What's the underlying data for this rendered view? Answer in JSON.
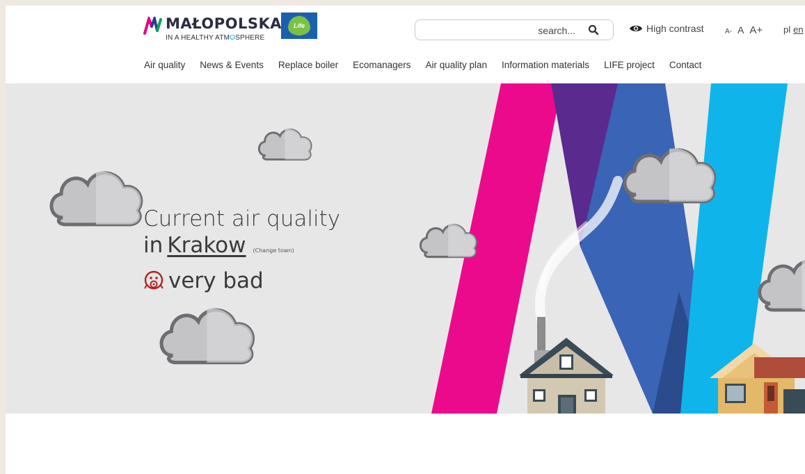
{
  "header": {
    "logo_title": "MAŁOPOLSKA",
    "logo_sub_1": "IN A HEALTHY ATM",
    "logo_sub_accent": "O",
    "logo_sub_2": "SPHERE",
    "life_label": "Life",
    "search": {
      "placeholder": "search..."
    },
    "high_contrast_label": "High contrast",
    "font_sizes": {
      "small": "A-",
      "normal": "A",
      "large": "A+"
    },
    "languages": {
      "pl": "pl",
      "en": "en",
      "active": "en"
    }
  },
  "nav": {
    "items": [
      {
        "label": "Air quality"
      },
      {
        "label": "News & Events"
      },
      {
        "label": "Replace boiler"
      },
      {
        "label": "Ecomanagers"
      },
      {
        "label": "Air quality plan"
      },
      {
        "label": "Information materials"
      },
      {
        "label": "LIFE project"
      },
      {
        "label": "Contact"
      }
    ]
  },
  "hero": {
    "headline_line1": "Current air quality",
    "headline_in": "in",
    "city": "Krakow",
    "change_town": "(Change town)",
    "status_label": "very bad",
    "colors": {
      "pink": "#ec0a8c",
      "purple": "#5a2a8e",
      "blue": "#3a64b5",
      "darkblue": "#2a4b8c",
      "cyan": "#0fb5ea",
      "status_icon": "#b02323"
    }
  }
}
